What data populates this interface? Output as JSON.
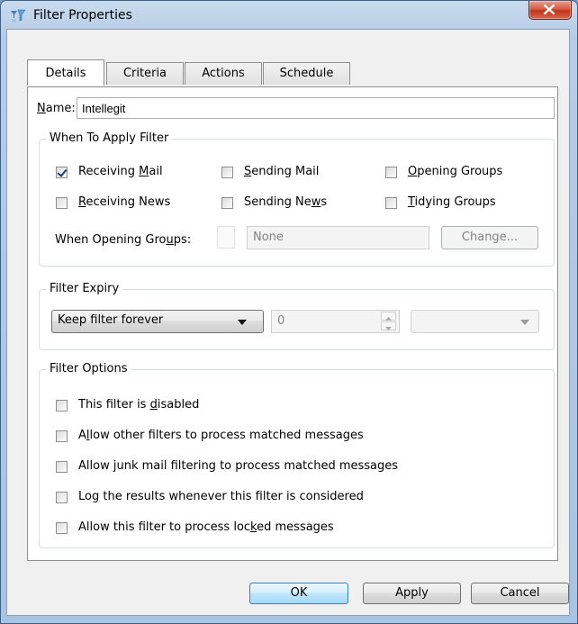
{
  "window": {
    "title": "Filter Properties"
  },
  "tabs": [
    {
      "label": "Details",
      "active": true
    },
    {
      "label": "Criteria",
      "active": false
    },
    {
      "label": "Actions",
      "active": false
    },
    {
      "label": "Schedule",
      "active": false
    }
  ],
  "name": {
    "label": "Name:",
    "value": "Intellegit"
  },
  "when_to_apply": {
    "title": "When To Apply Filter",
    "options": [
      {
        "label": "Receiving Mail",
        "checked": true
      },
      {
        "label": "Sending Mail",
        "checked": false
      },
      {
        "label": "Opening Groups",
        "checked": false
      },
      {
        "label": "Receiving News",
        "checked": false
      },
      {
        "label": "Sending News",
        "checked": false
      },
      {
        "label": "Tidying Groups",
        "checked": false
      }
    ],
    "opening_groups_label": "When Opening Groups:",
    "opening_groups_value": "None",
    "change_button": "Change..."
  },
  "expiry": {
    "title": "Filter Expiry",
    "mode": "Keep filter forever",
    "count": "0",
    "unit": ""
  },
  "options": {
    "title": "Filter Options",
    "items": [
      {
        "label": "This filter is disabled",
        "checked": false
      },
      {
        "label": "Allow other filters to process matched messages",
        "checked": false
      },
      {
        "label": "Allow junk mail filtering to process matched messages",
        "checked": false
      },
      {
        "label": "Log the results whenever this filter is considered",
        "checked": false
      },
      {
        "label": "Allow this filter to process locked messages",
        "checked": false
      }
    ]
  },
  "buttons": {
    "ok": "OK",
    "apply": "Apply",
    "cancel": "Cancel"
  }
}
